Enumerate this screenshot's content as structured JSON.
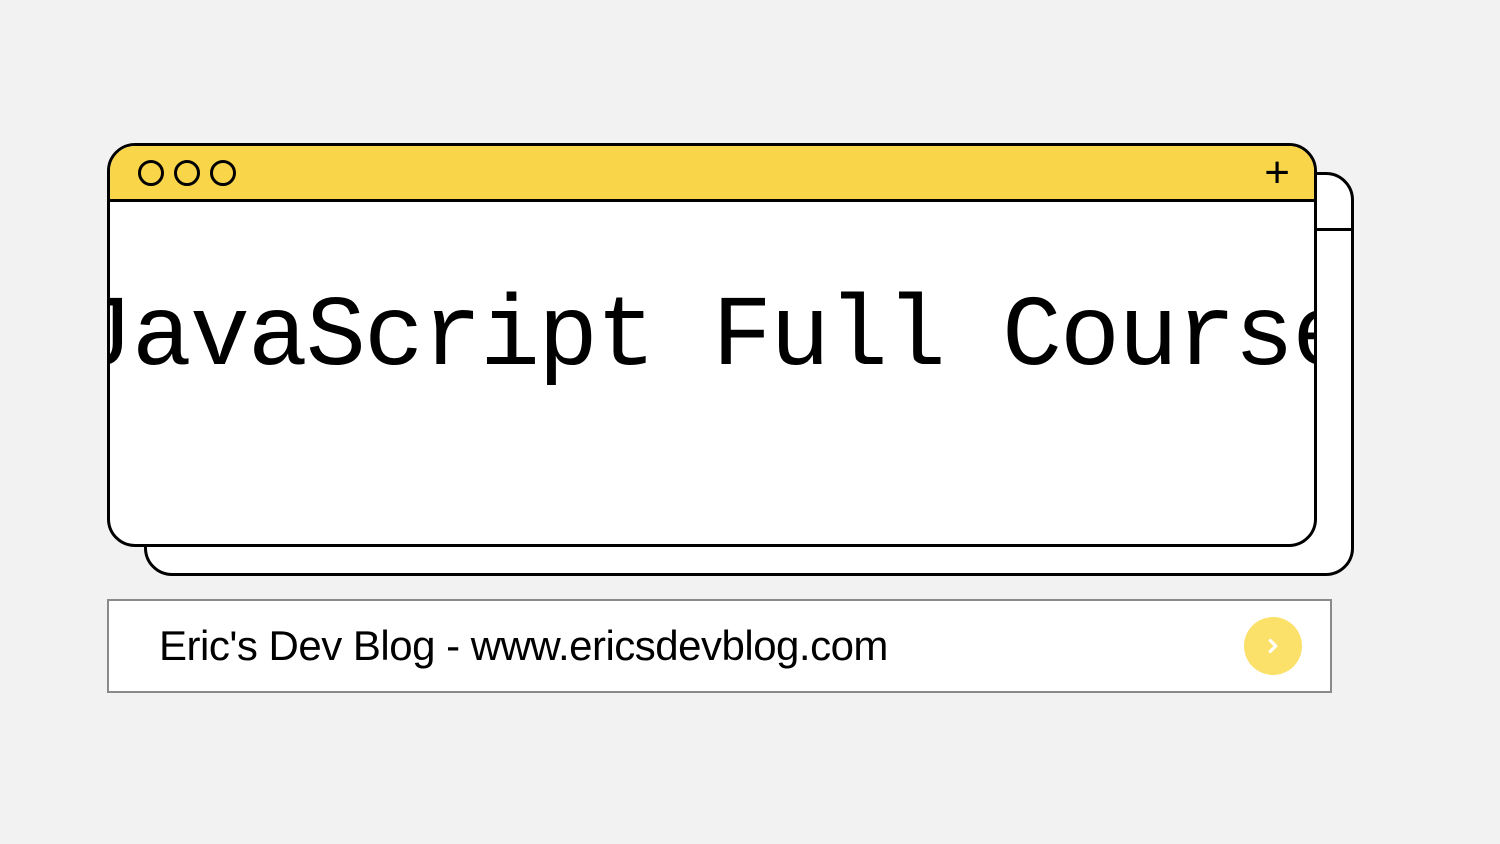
{
  "window": {
    "title": "JavaScript Full Course"
  },
  "addressBar": {
    "text": "Eric's Dev Blog - www.ericsdevblog.com"
  }
}
